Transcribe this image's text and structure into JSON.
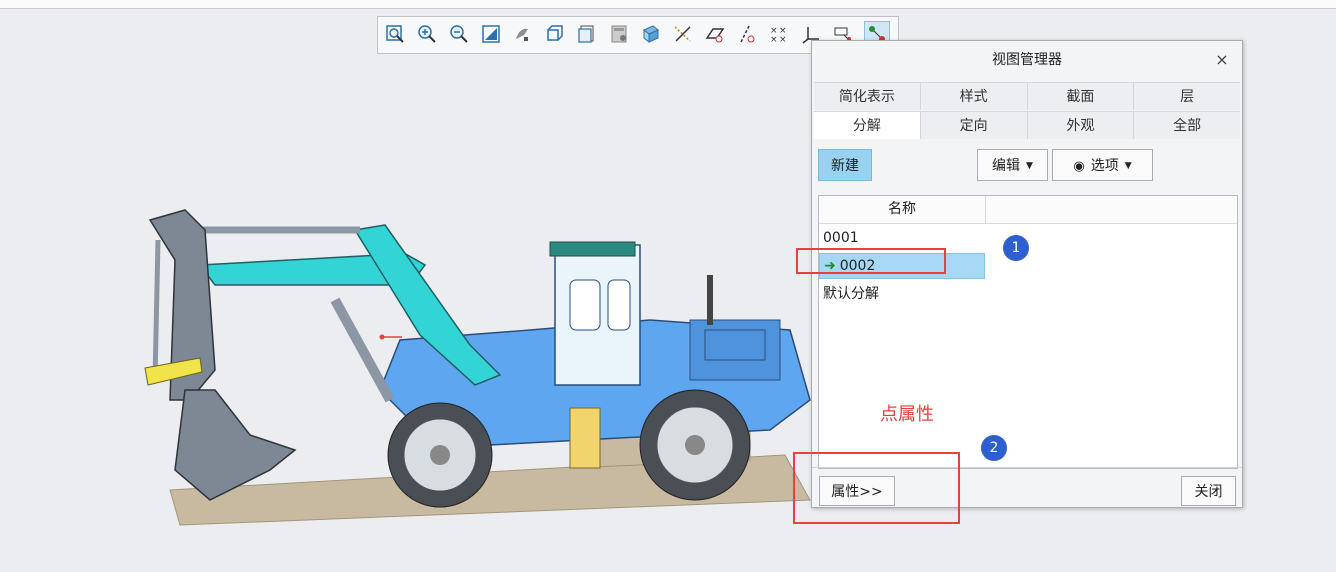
{
  "toolbar": {
    "icons": [
      "zoom-fit-icon",
      "zoom-in-icon",
      "zoom-out-icon",
      "repaint-icon",
      "saved-orientation-icon",
      "display-style-icon",
      "view-manager-icon",
      "perspective-icon",
      "section-icon",
      "datum-display-icon",
      "plane-display-icon",
      "axis-display-icon",
      "point-display-icon",
      "csys-display-icon",
      "annotation-display-icon",
      "spin-center-icon"
    ]
  },
  "dialog": {
    "title": "视图管理器",
    "close": "×",
    "tabs_row1": [
      "简化表示",
      "样式",
      "截面",
      "层"
    ],
    "tabs_row2": [
      "分解",
      "定向",
      "外观",
      "全部"
    ],
    "active_tab": "分解",
    "new_button": "新建",
    "edit_button": "编辑",
    "options_button": "选项",
    "list": {
      "column": "名称",
      "items": [
        "0001",
        "0002",
        "默认分解"
      ],
      "selected": "0002"
    },
    "properties_button": "属性>>",
    "close_button": "关闭"
  },
  "annotations": {
    "step1": "1",
    "step2": "2",
    "hint": "点属性"
  },
  "colors": {
    "accent": "#99d2f0",
    "annotation_red": "#e8413b",
    "badge_blue": "#2f5fcf"
  }
}
